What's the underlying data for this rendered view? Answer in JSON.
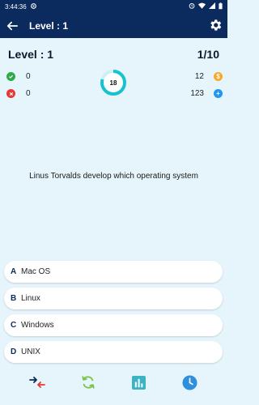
{
  "status_bar": {
    "time": "3:44:36"
  },
  "app_bar": {
    "title": "Level : 1"
  },
  "level": {
    "label": "Level : 1",
    "progress": "1/10"
  },
  "stats": {
    "correct": "0",
    "wrong": "0",
    "coins": "12",
    "points": "123"
  },
  "timer": {
    "value": "18"
  },
  "question": "Linus Torvalds develop which operating system",
  "options": [
    {
      "letter": "A",
      "text": "Mac OS"
    },
    {
      "letter": "B",
      "text": "Linux"
    },
    {
      "letter": "C",
      "text": "Windows"
    },
    {
      "letter": "D",
      "text": "UNIX"
    }
  ],
  "bottom_bar": {
    "icons": [
      "fifty-fifty-icon",
      "skip-icon",
      "audience-poll-icon",
      "timer-icon"
    ]
  },
  "colors": {
    "primary": "#0b2a5e",
    "background": "#e5f5fb",
    "correct": "#2eaa48",
    "wrong": "#e53935",
    "coin": "#f9a825",
    "add": "#2196f3",
    "timer": "#19c2cf"
  }
}
